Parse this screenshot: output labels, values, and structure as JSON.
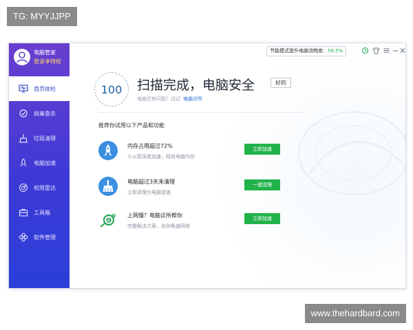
{
  "watermarks": {
    "top": "TG: MYYJJPP",
    "bottom": "www.thehardbard.com"
  },
  "profile": {
    "name": "电脑管家",
    "login_link": "登录享特权"
  },
  "sidebar": {
    "items": [
      {
        "label": "首页体检",
        "icon": "monitor-pulse-icon"
      },
      {
        "label": "病毒查杀",
        "icon": "virus-scan-icon"
      },
      {
        "label": "垃圾清理",
        "icon": "broom-icon"
      },
      {
        "label": "电脑加速",
        "icon": "rocket-icon"
      },
      {
        "label": "权限雷达",
        "icon": "radar-icon"
      },
      {
        "label": "工具箱",
        "icon": "toolbox-icon"
      },
      {
        "label": "软件管理",
        "icon": "apps-icon"
      }
    ]
  },
  "topbar": {
    "mode_text": "节能模式提升电脑流畅度：",
    "mode_pct": "58.5%"
  },
  "result": {
    "score": "100",
    "headline": "扫描完成，电脑安全",
    "badge": "好的",
    "sub_text": "电脑还有问题？试试",
    "sub_link": "电脑诊所"
  },
  "recommend": {
    "title": "推荐你试用以下产品和功能",
    "items": [
      {
        "title": "内存占用超过72%",
        "desc": "小火箭深度加速，释放电脑内存",
        "button": "立即加速",
        "icon": "rocket-icon"
      },
      {
        "title": "电脑超过3天未清理",
        "desc": "立即清理为电脑提速",
        "button": "一键清理",
        "icon": "broom-icon"
      },
      {
        "title": "上网慢？电脑诊所帮你",
        "desc": "完整解决方案，告别龟速网络",
        "button": "立即加速",
        "icon": "network-plug-icon"
      }
    ]
  },
  "colors": {
    "sidebar_top": "#6a3fd0",
    "sidebar_bottom": "#2b3fd8",
    "accent_green": "#21b24a",
    "link_blue": "#2f6fd1",
    "score_blue": "#1e5fa8"
  }
}
